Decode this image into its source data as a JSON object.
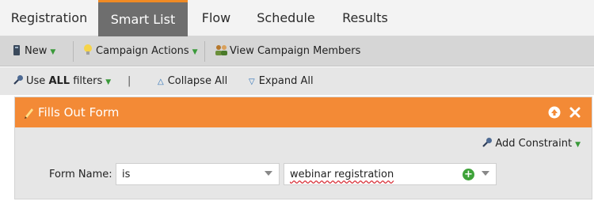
{
  "tabs": [
    {
      "label": "Registration",
      "active": false
    },
    {
      "label": "Smart List",
      "active": true
    },
    {
      "label": "Flow",
      "active": false
    },
    {
      "label": "Schedule",
      "active": false
    },
    {
      "label": "Results",
      "active": false
    }
  ],
  "toolbar": {
    "new_label": "New",
    "campaign_actions_label": "Campaign Actions",
    "view_members_label": "View Campaign Members"
  },
  "filterbar": {
    "use_label": "Use",
    "all_label": "ALL",
    "filters_label": "filters",
    "separator": "|",
    "collapse_label": "Collapse All",
    "expand_label": "Expand All"
  },
  "filter_panel": {
    "title": "Fills Out Form",
    "add_constraint_label": "Add Constraint",
    "field_label": "Form Name:",
    "operator_value": "is",
    "form_value": "webinar registration"
  },
  "colors": {
    "accent_orange": "#f38a36",
    "active_tab": "#6e6e6e",
    "caret_green": "#3a9a3a",
    "link_blue": "#2a6fb5"
  },
  "icons": [
    "notebook-icon",
    "lightbulb-icon",
    "people-icon",
    "filter-wrench-icon",
    "collapse-triangle-icon",
    "expand-triangle-icon",
    "pencil-icon",
    "move-up-icon",
    "close-icon",
    "add-icon"
  ]
}
